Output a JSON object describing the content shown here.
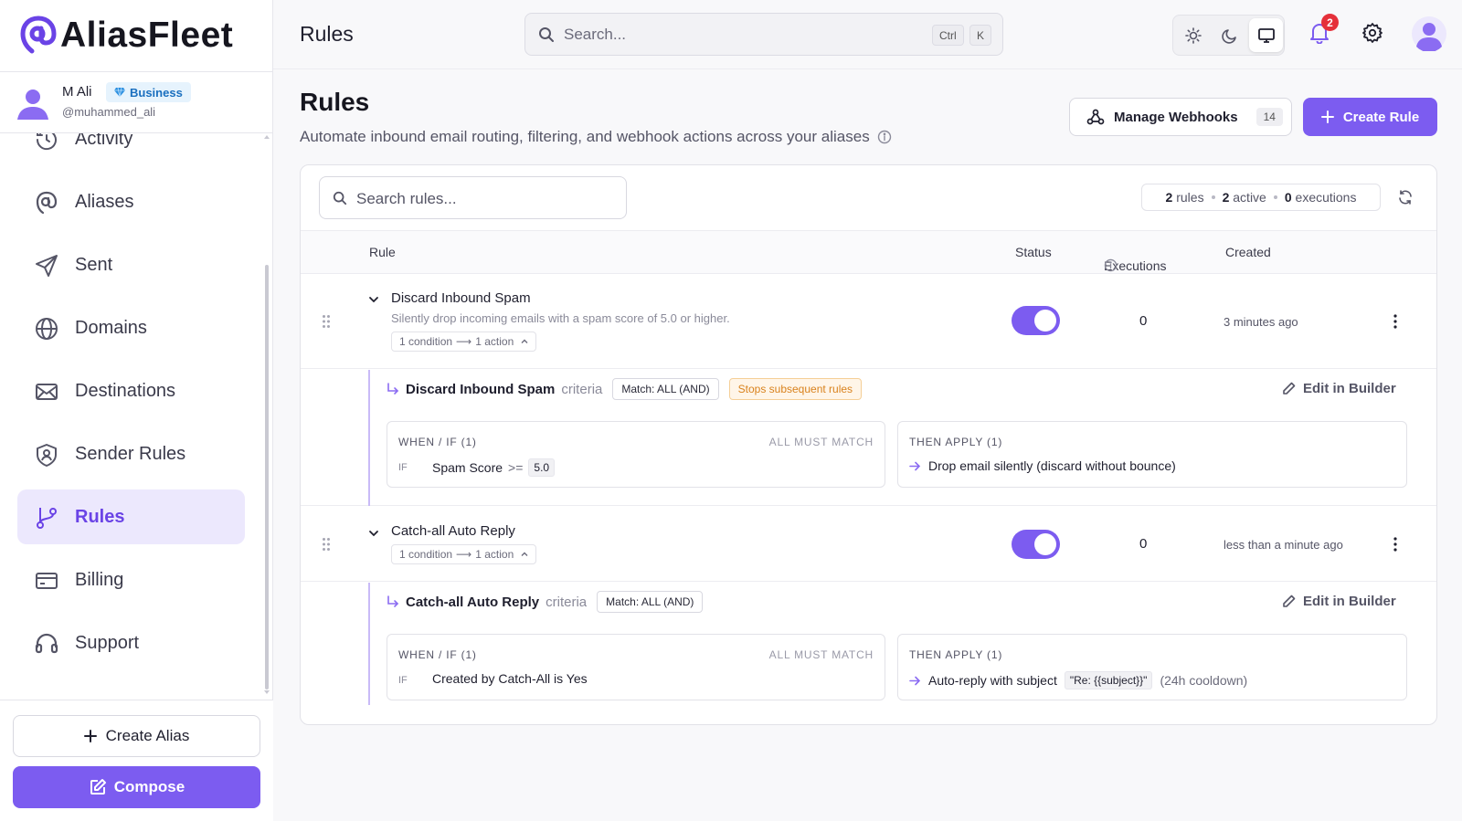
{
  "brand": {
    "name": "AliasFleet",
    "accent": "#7c5cf0"
  },
  "user": {
    "name": "M Ali",
    "plan": "Business",
    "handle": "@muhammed_ali"
  },
  "sidebar": {
    "items": [
      {
        "label": "Activity",
        "icon": "history-icon"
      },
      {
        "label": "Aliases",
        "icon": "alias-icon"
      },
      {
        "label": "Sent",
        "icon": "send-icon"
      },
      {
        "label": "Domains",
        "icon": "globe-icon"
      },
      {
        "label": "Destinations",
        "icon": "mail-icon"
      },
      {
        "label": "Sender Rules",
        "icon": "shield-user-icon"
      },
      {
        "label": "Rules",
        "icon": "branch-icon",
        "active": true
      },
      {
        "label": "Billing",
        "icon": "credit-card-icon"
      },
      {
        "label": "Support",
        "icon": "headset-icon"
      }
    ],
    "create_alias": "Create Alias",
    "compose": "Compose"
  },
  "topbar": {
    "title": "Rules",
    "search_placeholder": "Search...",
    "kbd_ctrl": "Ctrl",
    "kbd_k": "K",
    "theme": "system",
    "notifications": "2"
  },
  "page": {
    "title": "Rules",
    "subtitle": "Automate inbound email routing, filtering, and webhook actions across your aliases",
    "webhooks_label": "Manage Webhooks",
    "webhooks_count": "14",
    "create_rule": "Create Rule"
  },
  "rules_panel": {
    "search_placeholder": "Search rules...",
    "stats": {
      "rules_count": "2",
      "rules_label": "rules",
      "active_count": "2",
      "active_label": "active",
      "exec_count": "0",
      "exec_label": "executions"
    },
    "columns": {
      "rule": "Rule",
      "status": "Status",
      "executions": "Executions",
      "created": "Created"
    },
    "rules": [
      {
        "name": "Discard Inbound Spam",
        "description": "Silently drop incoming emails with a spam score of 5.0 or higher.",
        "summary_conditions": "1 condition",
        "summary_arrow": "⟶",
        "summary_actions": "1 action",
        "enabled": true,
        "executions": "0",
        "created": "3 minutes ago",
        "criteria_label": "criteria",
        "match": "Match: ALL (AND)",
        "stops": "Stops subsequent rules",
        "edit": "Edit in Builder",
        "when_head": "WHEN / IF (1)",
        "all_must_match": "ALL MUST MATCH",
        "if_label": "IF",
        "condition_field": "Spam Score",
        "condition_op": ">=",
        "condition_value": "5.0",
        "then_head": "THEN APPLY (1)",
        "action_text": "Drop email silently (discard without bounce)"
      },
      {
        "name": "Catch-all Auto Reply",
        "summary_conditions": "1 condition",
        "summary_arrow": "⟶",
        "summary_actions": "1 action",
        "enabled": true,
        "executions": "0",
        "created": "less than a minute ago",
        "criteria_label": "criteria",
        "match": "Match: ALL (AND)",
        "edit": "Edit in Builder",
        "when_head": "WHEN / IF (1)",
        "all_must_match": "ALL MUST MATCH",
        "if_label": "IF",
        "condition_text": "Created by Catch-All is Yes",
        "then_head": "THEN APPLY (1)",
        "action_text": "Auto-reply with subject",
        "action_code": "\"Re: {{subject}}\"",
        "action_suffix": "(24h cooldown)"
      }
    ]
  }
}
